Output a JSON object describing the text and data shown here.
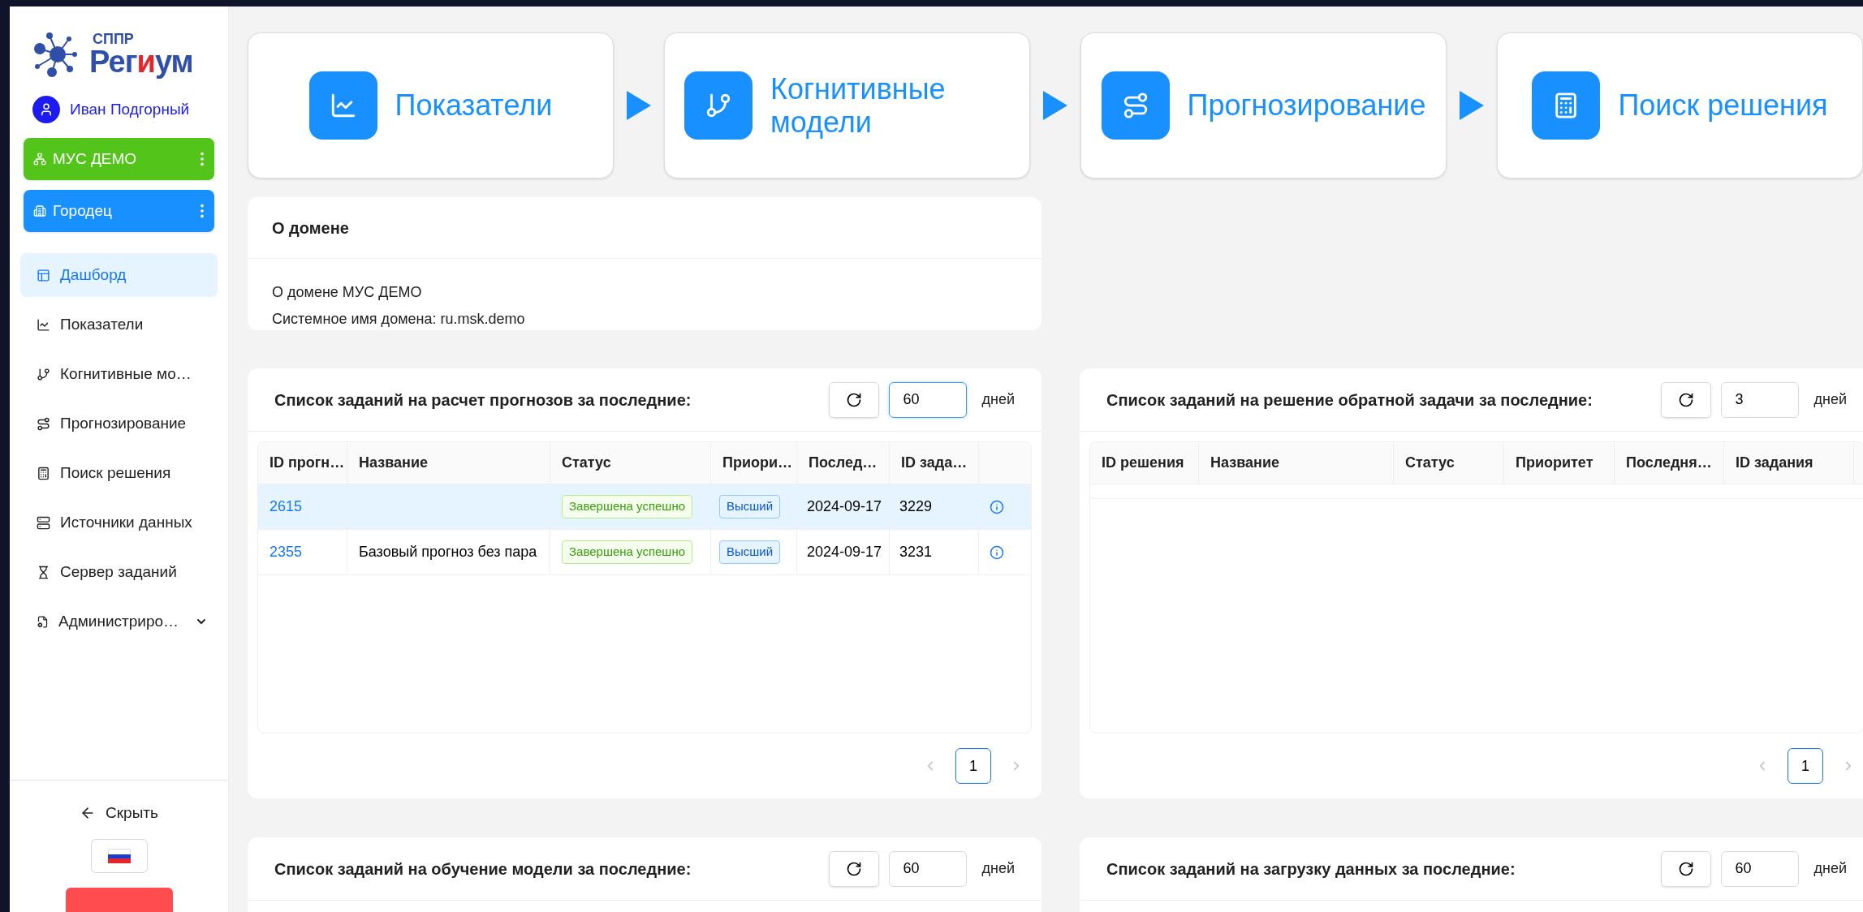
{
  "sidebar": {
    "logo": {
      "caption": "СППР",
      "name": [
        {
          "text": "Рег",
          "accent": false
        },
        {
          "text": "и",
          "accent": true
        },
        {
          "text": "ум",
          "accent": false
        }
      ]
    },
    "user": "Иван Подгорный",
    "domains": [
      {
        "label": "МУС ДЕМО",
        "color": "#52c41a"
      },
      {
        "label": "Городец",
        "color": "#1890ff"
      }
    ],
    "nav": [
      {
        "label": "Дашборд",
        "selected": true,
        "expandable": false
      },
      {
        "label": "Показатели",
        "selected": false,
        "expandable": false
      },
      {
        "label": "Когнитивные мо…",
        "selected": false,
        "expandable": false
      },
      {
        "label": "Прогнозирование",
        "selected": false,
        "expandable": false
      },
      {
        "label": "Поиск решения",
        "selected": false,
        "expandable": false
      },
      {
        "label": "Источники данных",
        "selected": false,
        "expandable": false
      },
      {
        "label": "Сервер заданий",
        "selected": false,
        "expandable": false
      },
      {
        "label": "Администриро…",
        "selected": false,
        "expandable": true
      }
    ],
    "collapse": "Скрыть"
  },
  "flow": [
    {
      "label": "Показатели"
    },
    {
      "label": "Когнитивные модели"
    },
    {
      "label": "Прогнозирование"
    },
    {
      "label": "Поиск решения"
    }
  ],
  "about": {
    "title": "О домене",
    "lines": [
      "О домене МУС ДЕМО",
      "Системное имя домена: ru.msk.demo"
    ]
  },
  "panels": [
    {
      "title": "Список заданий на расчет прогнозов за последние:",
      "days": "60",
      "unit": "дней",
      "focused": true,
      "columns": [
        "ID прогн…",
        "Название",
        "Статус",
        "Приори…",
        "Послед…",
        "ID зада…"
      ],
      "rows": [
        {
          "id": "2615",
          "status": "Завершена успешно",
          "priority": "Высший",
          "updated": "2024-09-17",
          "task_id": "3229",
          "highlighted": true
        },
        {
          "id": "2355",
          "name": "Базовый прогноз без пара",
          "status": "Завершена успешно",
          "priority": "Высший",
          "updated": "2024-09-17",
          "task_id": "3231",
          "highlighted": false
        }
      ],
      "page": "1"
    },
    {
      "title": "Список заданий на решение обратной задачи за последние:",
      "days": "3",
      "unit": "дней",
      "focused": false,
      "columns": [
        "ID решения",
        "Название",
        "Статус",
        "Приоритет",
        "Последня…",
        "ID задания"
      ],
      "page": "1"
    },
    {
      "title": "Список заданий на обучение модели за последние:",
      "days": "60",
      "unit": "дней",
      "focused": false
    },
    {
      "title": "Список заданий на загрузку данных за последние:",
      "days": "60",
      "unit": "дней",
      "focused": false
    }
  ]
}
